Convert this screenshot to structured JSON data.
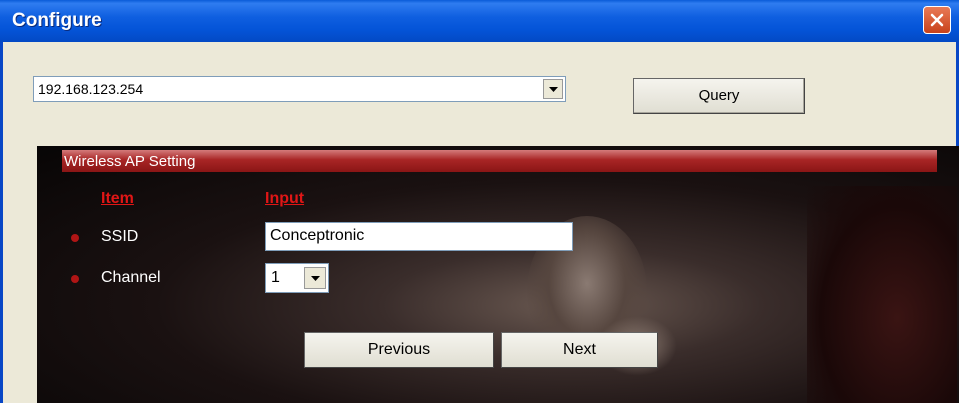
{
  "window": {
    "title": "Configure",
    "close_icon": "close-icon"
  },
  "ip_select": {
    "value": "192.168.123.254"
  },
  "query_button": {
    "label": "Query"
  },
  "panel": {
    "header": "Wireless AP Setting",
    "columns": {
      "item": "Item",
      "input": "Input"
    },
    "rows": [
      {
        "label": "SSID",
        "value": "Conceptronic"
      },
      {
        "label": "Channel",
        "value": "1"
      }
    ]
  },
  "buttons": {
    "previous": "Previous",
    "next": "Next"
  },
  "colors": {
    "title_bar": "#0454d8",
    "header_bar": "#a82525",
    "column_header": "#e01616",
    "bullet": "#b01515"
  }
}
